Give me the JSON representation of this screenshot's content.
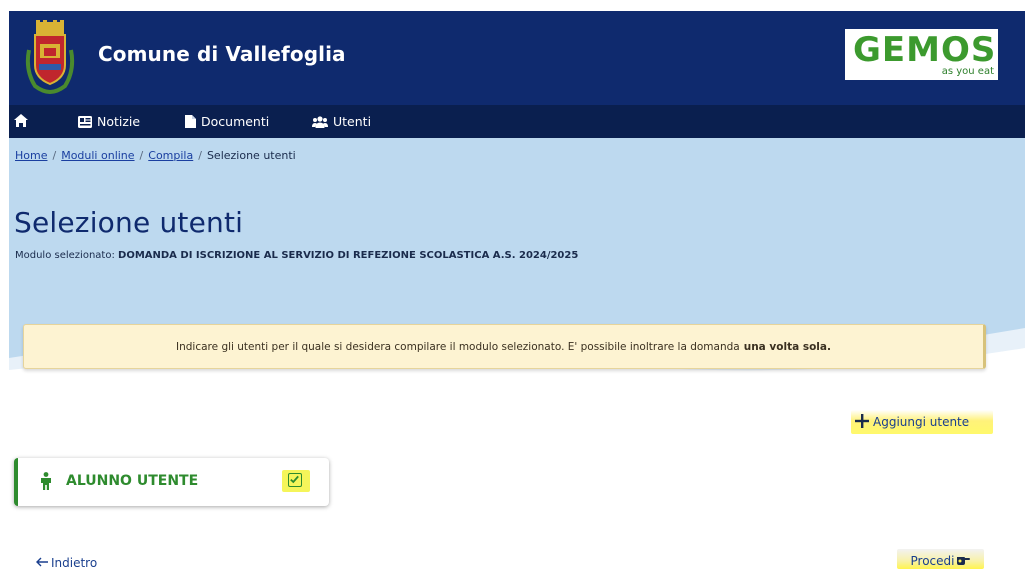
{
  "header": {
    "site_title": "Comune di Vallefoglia",
    "brand_word": "GEMOS",
    "brand_tagline": "as you eat",
    "crest_icon": "municipal-crest",
    "brand_color": "#3c9a2e"
  },
  "nav": {
    "items": [
      {
        "icon": "home-icon",
        "label": ""
      },
      {
        "icon": "newspaper-icon",
        "label": "Notizie"
      },
      {
        "icon": "document-icon",
        "label": "Documenti"
      },
      {
        "icon": "users-icon",
        "label": "Utenti"
      }
    ]
  },
  "breadcrumb": {
    "items": [
      "Home",
      "Moduli online",
      "Compila",
      "Selezione utenti"
    ],
    "separator": "/"
  },
  "page": {
    "title": "Selezione utenti",
    "module_prefix": "Modulo selezionato:",
    "module_name": "DOMANDA DI ISCRIZIONE AL SERVIZIO DI REFEZIONE SCOLASTICA A.S. 2024/2025"
  },
  "notice": {
    "text": "Indicare gli utenti per il quale si desidera compilare il modulo selezionato.  E' possibile inoltrare la domanda",
    "emphasis": "una volta sola."
  },
  "actions": {
    "add_user_label": "Aggiungi utente",
    "back_label": "Indietro",
    "proceed_label": "Procedi"
  },
  "users": [
    {
      "label": "ALUNNO UTENTE",
      "checked": true,
      "icon": "person-icon"
    }
  ],
  "colors": {
    "header_bg": "#0f2a6e",
    "nav_bg": "#0a1f4f",
    "hero_bg": "#bdd9ef",
    "accent_green": "#2e8b2e",
    "highlight": "#fff44d"
  }
}
